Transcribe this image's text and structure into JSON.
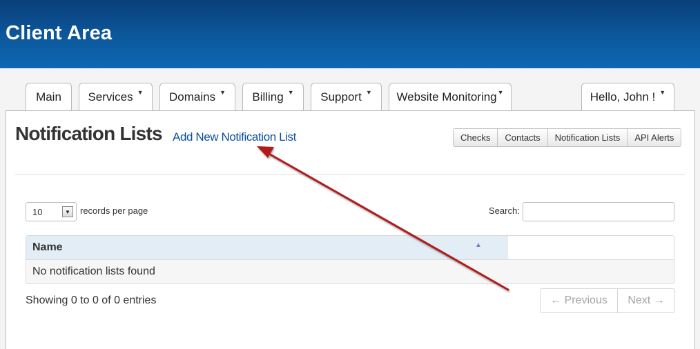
{
  "header": {
    "title": "Client Area"
  },
  "nav": {
    "tabs": [
      {
        "label": "Main",
        "caret": false
      },
      {
        "label": "Services",
        "caret": true
      },
      {
        "label": "Domains",
        "caret": true
      },
      {
        "label": "Billing",
        "caret": true
      },
      {
        "label": "Support",
        "caret": true
      },
      {
        "label": "Website Monitoring",
        "caret": true
      }
    ],
    "user": {
      "label": "Hello, John !",
      "caret": true
    }
  },
  "page": {
    "title": "Notification Lists",
    "add_link": "Add New Notification List"
  },
  "subnav": {
    "buttons": [
      "Checks",
      "Contacts",
      "Notification Lists",
      "API Alerts"
    ]
  },
  "table_controls": {
    "length_value": "10",
    "length_label": "records per page",
    "search_label": "Search:",
    "search_value": ""
  },
  "table": {
    "columns": [
      "Name"
    ],
    "empty_message": "No notification lists found"
  },
  "footer": {
    "info": "Showing 0 to 0 of 0 entries",
    "prev": "← Previous",
    "next": "Next →"
  },
  "colors": {
    "header_gradient_top": "#0a3f7a",
    "header_gradient_bottom": "#0e67b2",
    "link": "#0b4f9c",
    "annotation_arrow": "#b01c1c"
  }
}
